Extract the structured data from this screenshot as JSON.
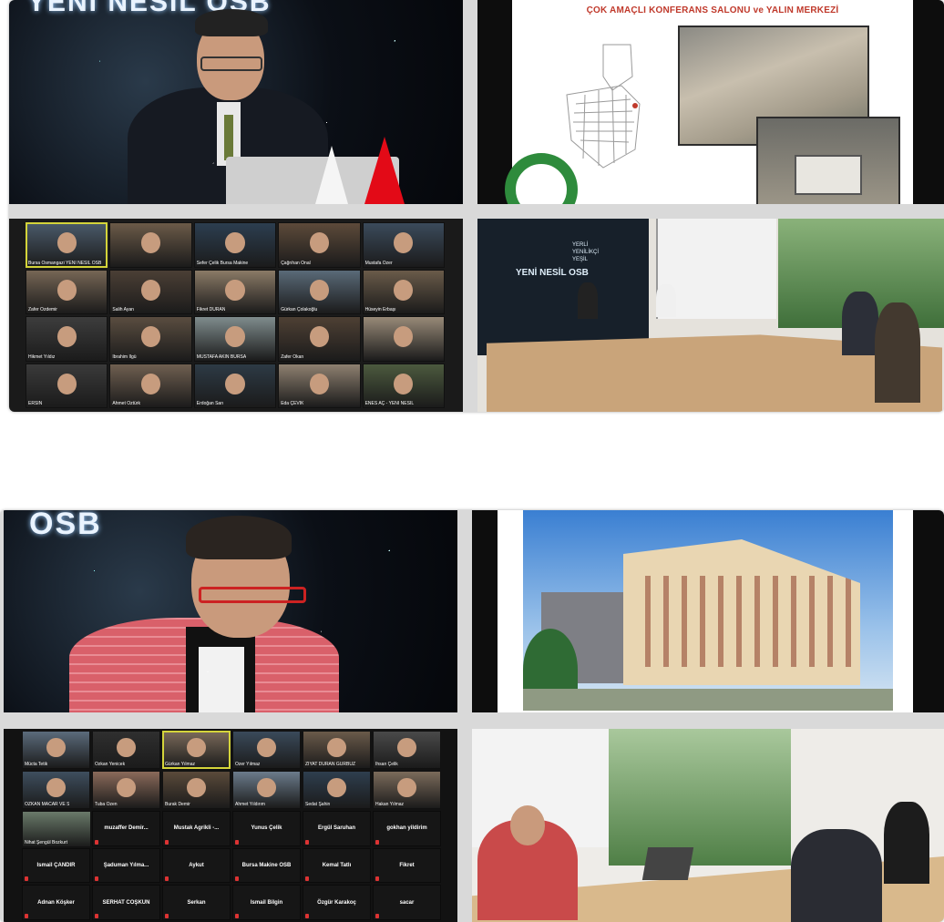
{
  "top_left": {
    "brand": "YENİ NESİL OSB"
  },
  "top_right": {
    "slide_title": "ÇOK AMAÇLI KONFERANS SALONU ve YALIN MERKEZİ"
  },
  "top_grid": {
    "participants": [
      {
        "name": "Bursa Osmangazi YENİ NESİL OSB"
      },
      {
        "name": ""
      },
      {
        "name": "Sefer Çelik Bursa Makine"
      },
      {
        "name": "Çağrıhan Önal"
      },
      {
        "name": "Mustafa Özer"
      },
      {
        "name": "Zafer Özdemir"
      },
      {
        "name": "Salih Ayan"
      },
      {
        "name": "Fikret DURAN"
      },
      {
        "name": "Gürkan Çolakoğlu"
      },
      {
        "name": "Hüseyin Erbaşı"
      },
      {
        "name": "Hikmet Yıldız"
      },
      {
        "name": "Ibrahim Ilgü"
      },
      {
        "name": "MUSTAFA AKIN BURSA"
      },
      {
        "name": "Zafer Okan"
      },
      {
        "name": ""
      },
      {
        "name": "ERSİN"
      },
      {
        "name": "Ahmet Öztürk"
      },
      {
        "name": "Erdoğan Sarı"
      },
      {
        "name": "Eda ÇEVİK"
      },
      {
        "name": "ENES AÇ - YENİ NESİL"
      }
    ]
  },
  "top_room": {
    "logo_lines": [
      "YENİ NESİL OSB",
      "YERLİ",
      "YENİLİKÇİ",
      "YEŞİL"
    ]
  },
  "bottom_left": {
    "brand": "OSB"
  },
  "bottom_grid": {
    "video_participants": [
      {
        "name": "Mücta Tetik"
      },
      {
        "name": "Özkan Yenicek"
      },
      {
        "name": "Gürkan Yılmaz"
      },
      {
        "name": "Özer Yılmaz"
      },
      {
        "name": "ZİYAT DURAN GÜRBÜZ"
      },
      {
        "name": "Ihsan Çelik"
      },
      {
        "name": "OZKAN MACAR VE S"
      },
      {
        "name": "Tuba Özen"
      },
      {
        "name": "Burak Demir"
      },
      {
        "name": "Ahmet Yıldırım"
      },
      {
        "name": "Sedat Şahin"
      },
      {
        "name": "Hakan Yılmaz"
      },
      {
        "name": "Nihat Şengül Bozkurt"
      }
    ],
    "name_tiles": [
      {
        "name": "muzaffer Demir..."
      },
      {
        "name": "Mustak Agrikli -..."
      },
      {
        "name": "Yunus Çelik"
      },
      {
        "name": "Ergül Saruhan"
      },
      {
        "name": "gokhan yildirim"
      },
      {
        "name": "Ismail ÇANDIR"
      },
      {
        "name": "Şaduman Yılma..."
      },
      {
        "name": "Aykut"
      },
      {
        "name": "Bursa Makine OSB"
      },
      {
        "name": "Kemal Tatlı"
      },
      {
        "name": "Fikret"
      },
      {
        "name": "Adnan Köşker"
      },
      {
        "name": "SERHAT COŞKUN"
      },
      {
        "name": "Serkan"
      },
      {
        "name": "Ismail Bilgin"
      },
      {
        "name": "Özgür Karakoç"
      },
      {
        "name": "sacar"
      }
    ]
  },
  "colors": {
    "accent_red": "#c0392b",
    "active_speaker": "#d4d43a",
    "frame": "#d9d9d9"
  }
}
